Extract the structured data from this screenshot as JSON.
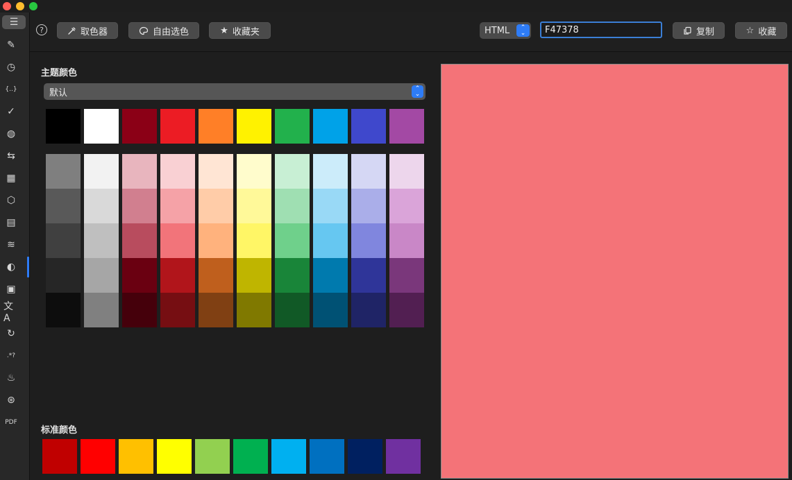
{
  "window": {
    "traffic_lights": [
      {
        "name": "close",
        "color": "#ff5f57"
      },
      {
        "name": "minimize",
        "color": "#febc2e"
      },
      {
        "name": "zoom",
        "color": "#28c840"
      }
    ]
  },
  "sidebar": {
    "items": [
      {
        "name": "menu-icon",
        "glyph": "☰"
      },
      {
        "name": "edit-icon",
        "glyph": "✎"
      },
      {
        "name": "clock-icon",
        "glyph": "◷"
      },
      {
        "name": "json-braces-icon",
        "glyph": "{..}"
      },
      {
        "name": "check-icon",
        "glyph": "✓"
      },
      {
        "name": "globe-icon",
        "glyph": "◍"
      },
      {
        "name": "swap-arrows-icon",
        "glyph": "⇆"
      },
      {
        "name": "qrcode-icon",
        "glyph": "▦"
      },
      {
        "name": "cube-icon",
        "glyph": "⬡"
      },
      {
        "name": "calculator-icon",
        "glyph": "▤"
      },
      {
        "name": "wifi-icon",
        "glyph": "≋"
      },
      {
        "name": "palette-icon",
        "glyph": "◐"
      },
      {
        "name": "image-icon",
        "glyph": "▣"
      },
      {
        "name": "translate-icon",
        "glyph": "文A"
      },
      {
        "name": "refresh-icon",
        "glyph": "↻"
      },
      {
        "name": "regex-icon",
        "glyph": ".*?"
      },
      {
        "name": "java-icon",
        "glyph": "♨"
      },
      {
        "name": "atom-icon",
        "glyph": "⊛"
      },
      {
        "name": "pdf-icon",
        "glyph": "PDF"
      }
    ],
    "active_index": 11
  },
  "toolbar": {
    "help_glyph": "?",
    "picker_label": "取色器",
    "free_select_label": "自由选色",
    "favorites_label": "收藏夹",
    "format_value": "HTML",
    "hex_value": "F47378",
    "copy_label": "复制",
    "collect_label": "收藏"
  },
  "theme": {
    "title": "主题颜色",
    "select_value": "默认",
    "base_colors": [
      "#000000",
      "#FFFFFF",
      "#8B0016",
      "#EC1C24",
      "#FF7F27",
      "#FFF200",
      "#22B14C",
      "#00A2E8",
      "#3F48CC",
      "#A349A4"
    ],
    "shade_columns": [
      [
        "#7F7F7F",
        "#595959",
        "#404040",
        "#262626",
        "#0D0D0D"
      ],
      [
        "#F2F2F2",
        "#D9D9D9",
        "#BFBFBF",
        "#A6A6A6",
        "#808080"
      ],
      [
        "#E8B5BE",
        "#D17F8F",
        "#B84C5E",
        "#6A0011",
        "#45000B"
      ],
      [
        "#F9D0D3",
        "#F5A2A7",
        "#F2747A",
        "#B1151B",
        "#760E12"
      ],
      [
        "#FFE5D4",
        "#FFCCA8",
        "#FFB27D",
        "#BF5F1D",
        "#804013"
      ],
      [
        "#FFFCCC",
        "#FFF999",
        "#FFF666",
        "#BFB500",
        "#807900"
      ],
      [
        "#C8EFD4",
        "#9FDFB2",
        "#6FD08B",
        "#198539",
        "#115926"
      ],
      [
        "#CCECFA",
        "#99D9F6",
        "#66C7F1",
        "#007AAE",
        "#005174"
      ],
      [
        "#D5D7F4",
        "#AAAEE9",
        "#8086DE",
        "#2F3599",
        "#1F2466"
      ],
      [
        "#EDD6EC",
        "#DAA4D9",
        "#C987C7",
        "#7A377B",
        "#521F52"
      ]
    ]
  },
  "standard": {
    "title": "标准颜色",
    "colors": [
      "#C00000",
      "#FF0000",
      "#FFC000",
      "#FFFF00",
      "#92D050",
      "#00B050",
      "#00B0F0",
      "#0070C0",
      "#002060",
      "#7030A0"
    ]
  },
  "preview": {
    "color": "#F47378"
  }
}
